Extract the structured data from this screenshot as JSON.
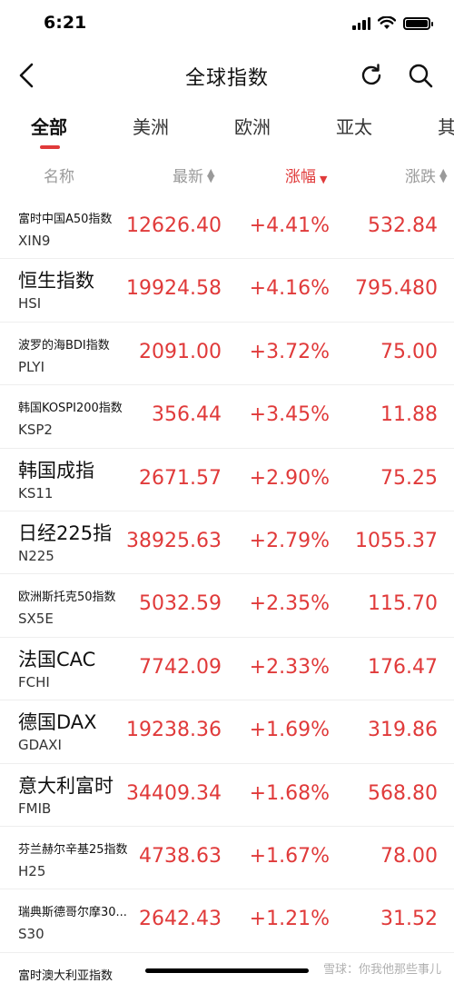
{
  "status": {
    "time": "6:21"
  },
  "header": {
    "title": "全球指数"
  },
  "tabs": [
    {
      "label": "全部"
    },
    {
      "label": "美洲"
    },
    {
      "label": "欧洲"
    },
    {
      "label": "亚太"
    },
    {
      "label": "其"
    }
  ],
  "columns": {
    "name": "名称",
    "latest": "最新",
    "change_pct": "涨幅",
    "change": "涨跌"
  },
  "rows": [
    {
      "name": "富时中国A50指数",
      "code": "XIN9",
      "price": "12626.40",
      "pct": "+4.41%",
      "change": "532.84"
    },
    {
      "name": "恒生指数",
      "code": "HSI",
      "price": "19924.58",
      "pct": "+4.16%",
      "change": "795.480"
    },
    {
      "name": "波罗的海BDI指数",
      "code": "PLYI",
      "price": "2091.00",
      "pct": "+3.72%",
      "change": "75.00"
    },
    {
      "name": "韩国KOSPI200指数",
      "code": "KSP2",
      "price": "356.44",
      "pct": "+3.45%",
      "change": "11.88"
    },
    {
      "name": "韩国成指",
      "code": "KS11",
      "price": "2671.57",
      "pct": "+2.90%",
      "change": "75.25"
    },
    {
      "name": "日经225指",
      "code": "N225",
      "price": "38925.63",
      "pct": "+2.79%",
      "change": "1055.37"
    },
    {
      "name": "欧洲斯托克50指数",
      "code": "SX5E",
      "price": "5032.59",
      "pct": "+2.35%",
      "change": "115.70"
    },
    {
      "name": "法国CAC",
      "code": "FCHI",
      "price": "7742.09",
      "pct": "+2.33%",
      "change": "176.47"
    },
    {
      "name": "德国DAX",
      "code": "GDAXI",
      "price": "19238.36",
      "pct": "+1.69%",
      "change": "319.86"
    },
    {
      "name": "意大利富时",
      "code": "FMIB",
      "price": "34409.34",
      "pct": "+1.68%",
      "change": "568.80"
    },
    {
      "name": "芬兰赫尔辛基25指数",
      "code": "H25",
      "price": "4738.63",
      "pct": "+1.67%",
      "change": "78.00"
    },
    {
      "name": "瑞典斯德哥尔摩30...",
      "code": "S30",
      "price": "2642.43",
      "pct": "+1.21%",
      "change": "31.52"
    },
    {
      "name": "富时澳大利亚指数",
      "code": "",
      "price": "",
      "pct": "",
      "change": ""
    }
  ],
  "watermark": "雪球：你我他那些事儿",
  "colors": {
    "up": "#e03a3a",
    "accent": "#e03a3a",
    "muted": "#9a9a9a"
  },
  "icons": [
    "back-arrow-icon",
    "refresh-icon",
    "search-icon",
    "sort-icon"
  ]
}
